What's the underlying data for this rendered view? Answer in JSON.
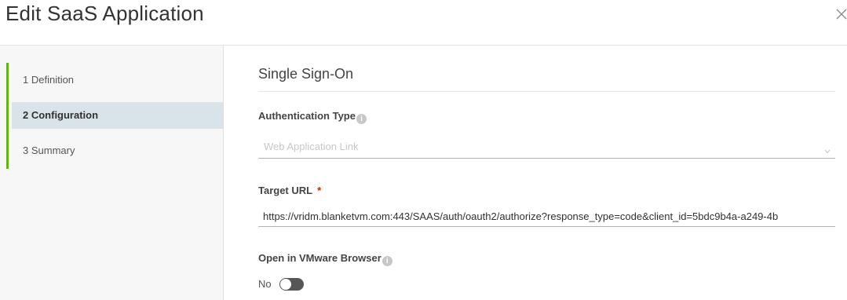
{
  "dialog": {
    "title": "Edit SaaS Application",
    "close_icon": "close-icon"
  },
  "steps": [
    {
      "label": "1  Definition",
      "active": false
    },
    {
      "label": "2  Configuration",
      "active": true
    },
    {
      "label": "3  Summary",
      "active": false
    }
  ],
  "section": {
    "title": "Single Sign-On"
  },
  "auth_type": {
    "label": "Authentication Type",
    "info_icon": "info-icon",
    "value": "Web Application Link"
  },
  "target_url": {
    "label": "Target URL",
    "required_mark": "*",
    "value": "https://vridm.blanketvm.com:443/SAAS/auth/oauth2/authorize?response_type=code&client_id=5bdc9b4a-a249-4b"
  },
  "vmware_browser": {
    "label": "Open in VMware Browser",
    "info_icon": "info-icon",
    "state_label": "No",
    "enabled": false
  },
  "colors": {
    "accent_green": "#60b515",
    "active_step_bg": "#d9e4ea",
    "required": "#c92100"
  }
}
